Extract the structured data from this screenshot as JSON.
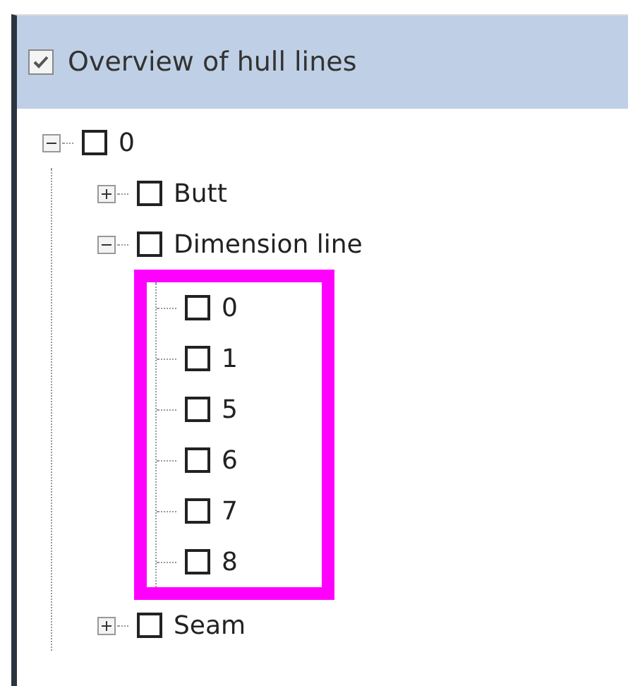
{
  "header": {
    "title": "Overview of hull lines",
    "checked": true
  },
  "tree": [
    {
      "label": "0",
      "checked": false,
      "expanded": true,
      "children": [
        {
          "label": "Butt",
          "checked": false,
          "expanded": false
        },
        {
          "label": "Dimension line",
          "checked": false,
          "expanded": true,
          "highlighted": true,
          "children": [
            {
              "label": "0",
              "checked": false
            },
            {
              "label": "1",
              "checked": false
            },
            {
              "label": "5",
              "checked": false
            },
            {
              "label": "6",
              "checked": false
            },
            {
              "label": "7",
              "checked": false
            },
            {
              "label": "8",
              "checked": false
            }
          ]
        },
        {
          "label": "Seam",
          "checked": false,
          "expanded": false
        }
      ]
    }
  ]
}
